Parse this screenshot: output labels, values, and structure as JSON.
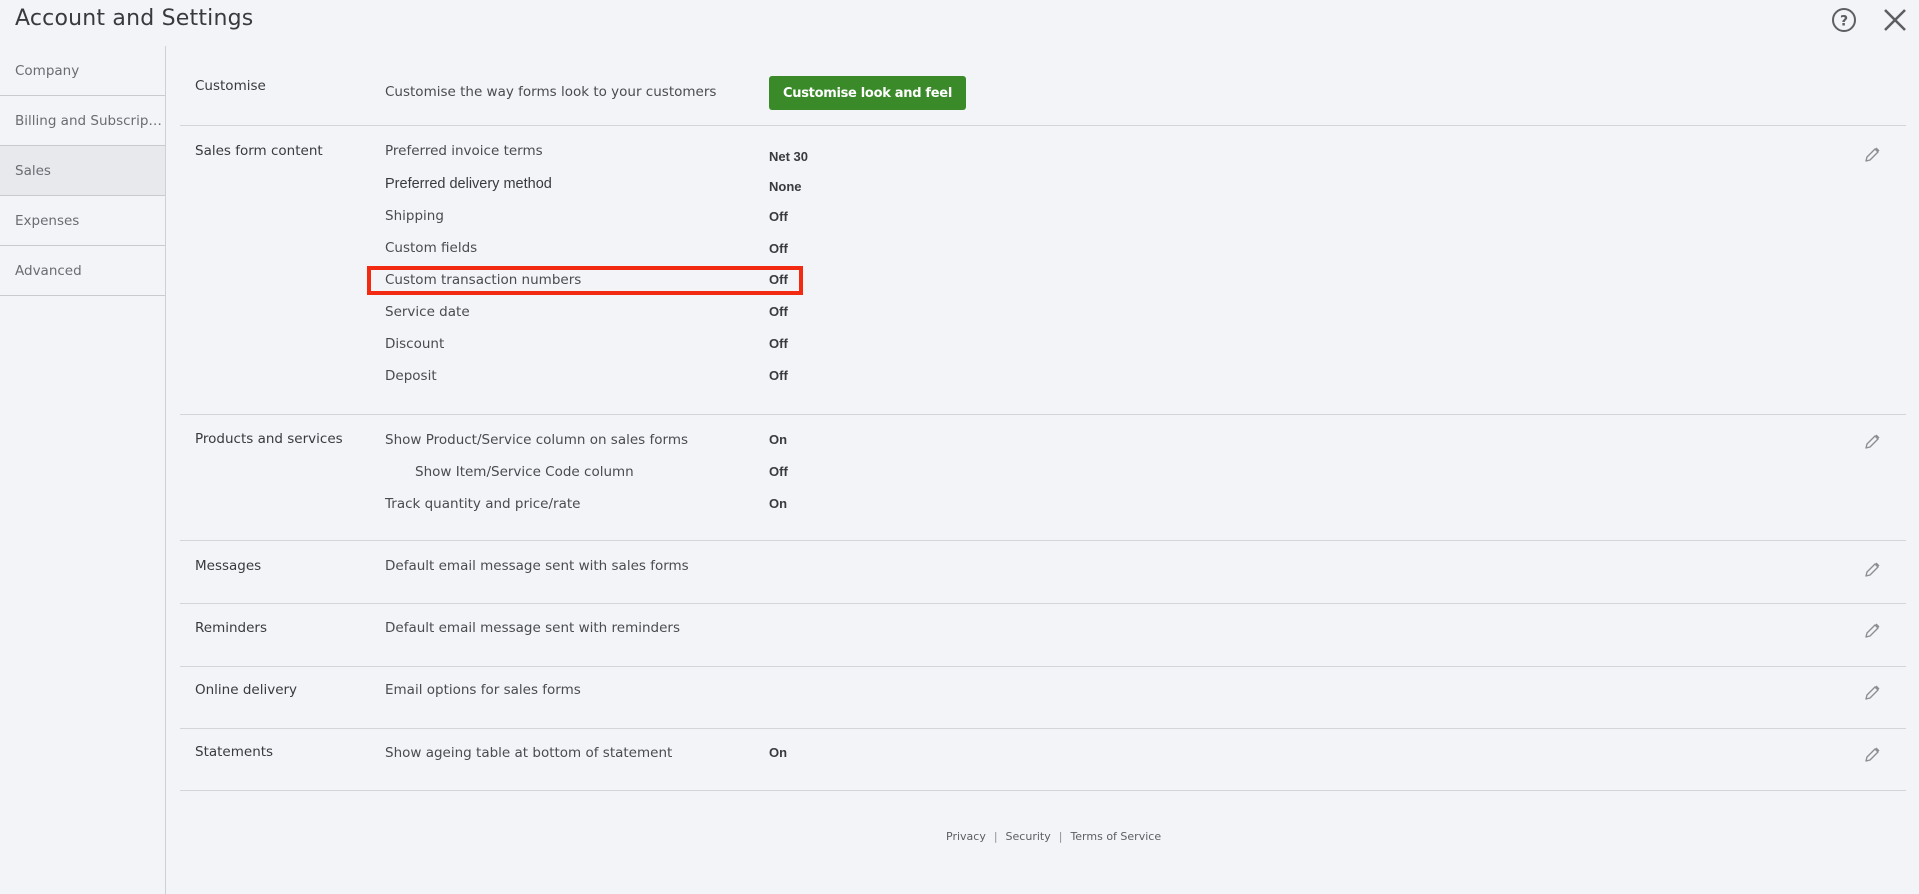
{
  "header": {
    "title": "Account and Settings",
    "help_icon": "question-circle-icon",
    "close_icon": "close-x-icon"
  },
  "sidebar": {
    "items": [
      {
        "label": "Company",
        "active": false
      },
      {
        "label": "Billing and Subscripti...",
        "active": false
      },
      {
        "label": "Sales",
        "active": true
      },
      {
        "label": "Expenses",
        "active": false
      },
      {
        "label": "Advanced",
        "active": false
      }
    ]
  },
  "sections": {
    "customise": {
      "title": "Customise",
      "description": "Customise the way forms look to your customers",
      "button_label": "Customise look and feel",
      "button_color": "#3b8a2a"
    },
    "sales_form_content": {
      "title": "Sales form content",
      "rows": [
        {
          "label": "Preferred invoice terms",
          "value": "Net 30"
        },
        {
          "label": "Preferred delivery method",
          "value": "None"
        },
        {
          "label": "Shipping",
          "value": "Off"
        },
        {
          "label": "Custom fields",
          "value": "Off"
        },
        {
          "label": "Custom transaction numbers",
          "value": "Off",
          "highlighted": true
        },
        {
          "label": "Service date",
          "value": "Off"
        },
        {
          "label": "Discount",
          "value": "Off"
        },
        {
          "label": "Deposit",
          "value": "Off"
        }
      ]
    },
    "products_and_services": {
      "title": "Products and services",
      "rows": [
        {
          "label": "Show Product/Service column on sales forms",
          "value": "On"
        },
        {
          "label": "Show Item/Service Code column",
          "value": "Off"
        },
        {
          "label": "Track quantity and price/rate",
          "value": "On"
        }
      ]
    },
    "messages": {
      "title": "Messages",
      "description": "Default email message sent with sales forms"
    },
    "reminders": {
      "title": "Reminders",
      "description": "Default email message sent with reminders"
    },
    "online_delivery": {
      "title": "Online delivery",
      "description": "Email options for sales forms"
    },
    "statements": {
      "title": "Statements",
      "description": "Show ageing table at bottom of statement",
      "value": "On"
    }
  },
  "annotation": {
    "highlight_color": "#f32a12",
    "highlighted_row": "Custom transaction numbers"
  },
  "footer": {
    "links": [
      "Privacy",
      "Security",
      "Terms of Service"
    ],
    "separator": "|"
  }
}
